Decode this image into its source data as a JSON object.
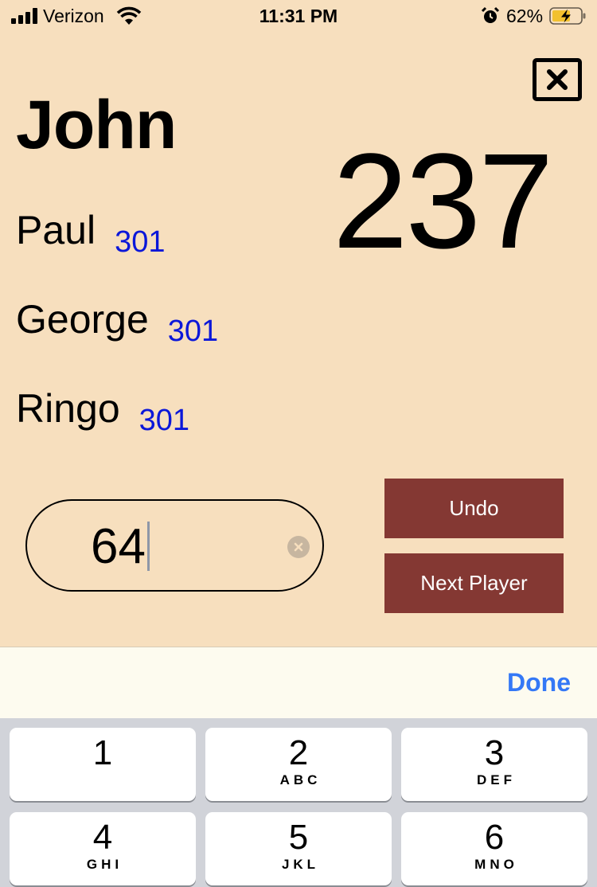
{
  "status_bar": {
    "carrier": "Verizon",
    "time": "11:31 PM",
    "battery_percent": "62%",
    "icons": [
      "signal-icon",
      "wifi-icon",
      "alarm-icon",
      "battery-charging-icon"
    ]
  },
  "game": {
    "current_player": "John",
    "current_score": "237",
    "other_players": [
      {
        "name": "Paul",
        "score": "301"
      },
      {
        "name": "George",
        "score": "301"
      },
      {
        "name": "Ringo",
        "score": "301"
      }
    ]
  },
  "input": {
    "value": "64"
  },
  "actions": {
    "undo_label": "Undo",
    "next_label": "Next Player"
  },
  "keyboard": {
    "done_label": "Done",
    "keys": [
      {
        "digit": "1",
        "letters": ""
      },
      {
        "digit": "2",
        "letters": "ABC"
      },
      {
        "digit": "3",
        "letters": "DEF"
      },
      {
        "digit": "4",
        "letters": "GHI"
      },
      {
        "digit": "5",
        "letters": "JKL"
      },
      {
        "digit": "6",
        "letters": "MNO"
      }
    ]
  },
  "colors": {
    "background": "#f7dfbe",
    "button": "#843833",
    "score_blue": "#0b17d9",
    "done_blue": "#3478f6"
  }
}
